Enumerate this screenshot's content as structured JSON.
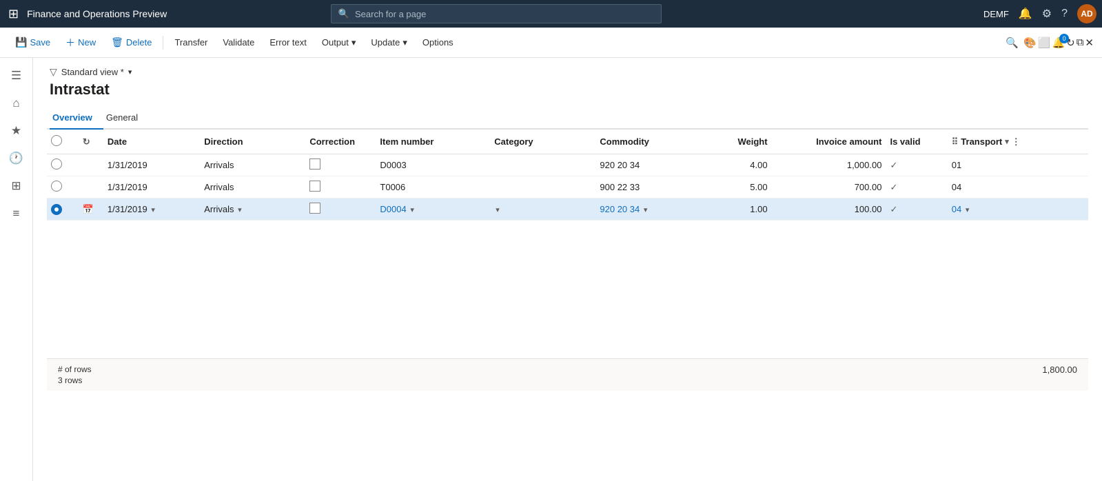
{
  "app": {
    "title": "Finance and Operations Preview",
    "env": "DEMF"
  },
  "search": {
    "placeholder": "Search for a page"
  },
  "topnav": {
    "notification_count": "0",
    "avatar_initials": "AD",
    "icons": [
      "notifications",
      "settings",
      "help",
      "avatar"
    ]
  },
  "toolbar": {
    "save_label": "Save",
    "new_label": "New",
    "delete_label": "Delete",
    "transfer_label": "Transfer",
    "validate_label": "Validate",
    "error_text_label": "Error text",
    "output_label": "Output",
    "update_label": "Update",
    "options_label": "Options"
  },
  "view": {
    "label": "Standard view *",
    "caret": "▾"
  },
  "page": {
    "title": "Intrastat"
  },
  "tabs": [
    {
      "id": "overview",
      "label": "Overview",
      "active": true
    },
    {
      "id": "general",
      "label": "General",
      "active": false
    }
  ],
  "table": {
    "columns": [
      {
        "id": "select",
        "label": ""
      },
      {
        "id": "refresh",
        "label": ""
      },
      {
        "id": "date",
        "label": "Date"
      },
      {
        "id": "direction",
        "label": "Direction"
      },
      {
        "id": "correction",
        "label": "Correction"
      },
      {
        "id": "item_number",
        "label": "Item number"
      },
      {
        "id": "category",
        "label": "Category"
      },
      {
        "id": "commodity",
        "label": "Commodity"
      },
      {
        "id": "weight",
        "label": "Weight",
        "align": "right"
      },
      {
        "id": "invoice_amount",
        "label": "Invoice amount",
        "align": "right"
      },
      {
        "id": "is_valid",
        "label": "Is valid"
      },
      {
        "id": "transport",
        "label": "Transport"
      },
      {
        "id": "more",
        "label": ""
      }
    ],
    "rows": [
      {
        "id": "row1",
        "selected": false,
        "date": "1/31/2019",
        "direction": "Arrivals",
        "correction": false,
        "item_number": "D0003",
        "item_link": false,
        "category": "",
        "commodity": "920 20 34",
        "weight": "4.00",
        "invoice_amount": "1,000.00",
        "is_valid": true,
        "transport": "01"
      },
      {
        "id": "row2",
        "selected": false,
        "date": "1/31/2019",
        "direction": "Arrivals",
        "correction": false,
        "item_number": "T0006",
        "item_link": false,
        "category": "",
        "commodity": "900 22 33",
        "weight": "5.00",
        "invoice_amount": "700.00",
        "is_valid": true,
        "transport": "04"
      },
      {
        "id": "row3",
        "selected": true,
        "date": "1/31/2019",
        "direction": "Arrivals",
        "correction": false,
        "item_number": "D0004",
        "item_link": true,
        "category": "",
        "commodity": "920 20 34",
        "weight": "1.00",
        "invoice_amount": "100.00",
        "is_valid": true,
        "transport": "04"
      }
    ]
  },
  "footer": {
    "rows_label": "# of rows",
    "rows_count": "3 rows",
    "total_value": "1,800.00"
  },
  "sidebar_icons": [
    {
      "name": "hamburger-menu",
      "symbol": "☰"
    },
    {
      "name": "home",
      "symbol": "⌂"
    },
    {
      "name": "favorites",
      "symbol": "★"
    },
    {
      "name": "recent",
      "symbol": "🕐"
    },
    {
      "name": "workspaces",
      "symbol": "⊞"
    },
    {
      "name": "modules",
      "symbol": "≡"
    }
  ]
}
